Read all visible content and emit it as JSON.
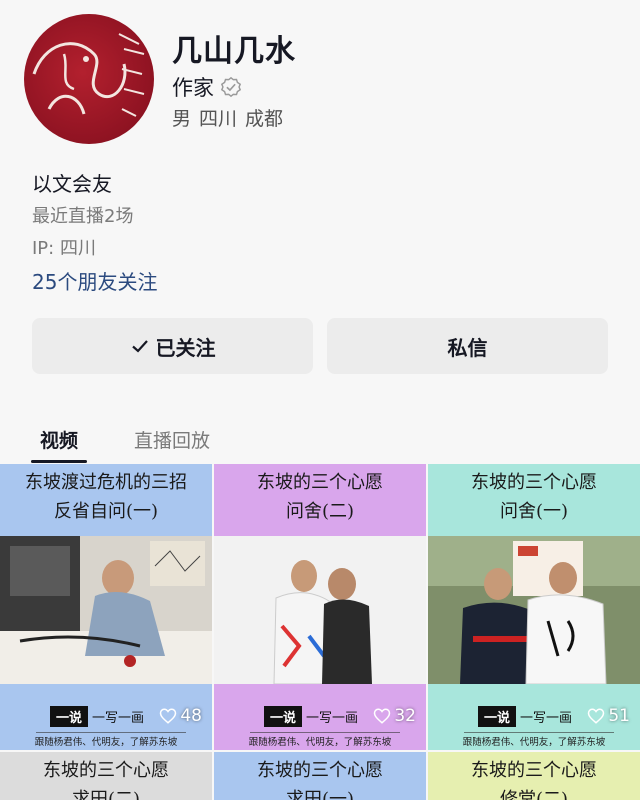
{
  "profile": {
    "name": "几山几水",
    "role": "作家",
    "gender": "男",
    "province": "四川",
    "city": "成都",
    "bio": "以文会友",
    "live_count": "最近直播2场",
    "ip": "IP: 四川",
    "friends_following": "25个朋友关注"
  },
  "actions": {
    "follow_label": "已关注",
    "message_label": "私信"
  },
  "tabs": [
    {
      "label": "视频"
    },
    {
      "label": "直播回放"
    }
  ],
  "videos": [
    {
      "line1": "东坡渡过危机的三招",
      "line2": "反省自问(一)",
      "likes": "48",
      "tag_box": "一说",
      "tag_rest": "一写一画",
      "sub": "跟随杨君伟、代明友，了解苏东坡",
      "head_color": "#a9c6ef",
      "foot_color": "#a9c6ef"
    },
    {
      "line1": "东坡的三个心愿",
      "line2": "问舍(二)",
      "likes": "32",
      "tag_box": "一说",
      "tag_rest": "一写一画",
      "sub": "跟随杨君伟、代明友，了解苏东坡",
      "head_color": "#d9a6ec",
      "foot_color": "#d9a6ec"
    },
    {
      "line1": "东坡的三个心愿",
      "line2": "问舍(一)",
      "likes": "51",
      "tag_box": "一说",
      "tag_rest": "一写一画",
      "sub": "跟随杨君伟、代明友，了解苏东坡",
      "head_color": "#a8e6dc",
      "foot_color": "#a8e6dc"
    }
  ],
  "videos_row2": [
    {
      "line1": "东坡的三个心愿",
      "line2": "求田(二)",
      "head_color": "#dcdcdc"
    },
    {
      "line1": "东坡的三个心愿",
      "line2": "求田(一)",
      "head_color": "#a9c6ef"
    },
    {
      "line1": "东坡的三个心愿",
      "line2": "修堂(二)",
      "head_color": "#e6efb0"
    }
  ],
  "colors": {
    "friends_link": "#2b4a7f",
    "button_bg": "#ececec"
  }
}
